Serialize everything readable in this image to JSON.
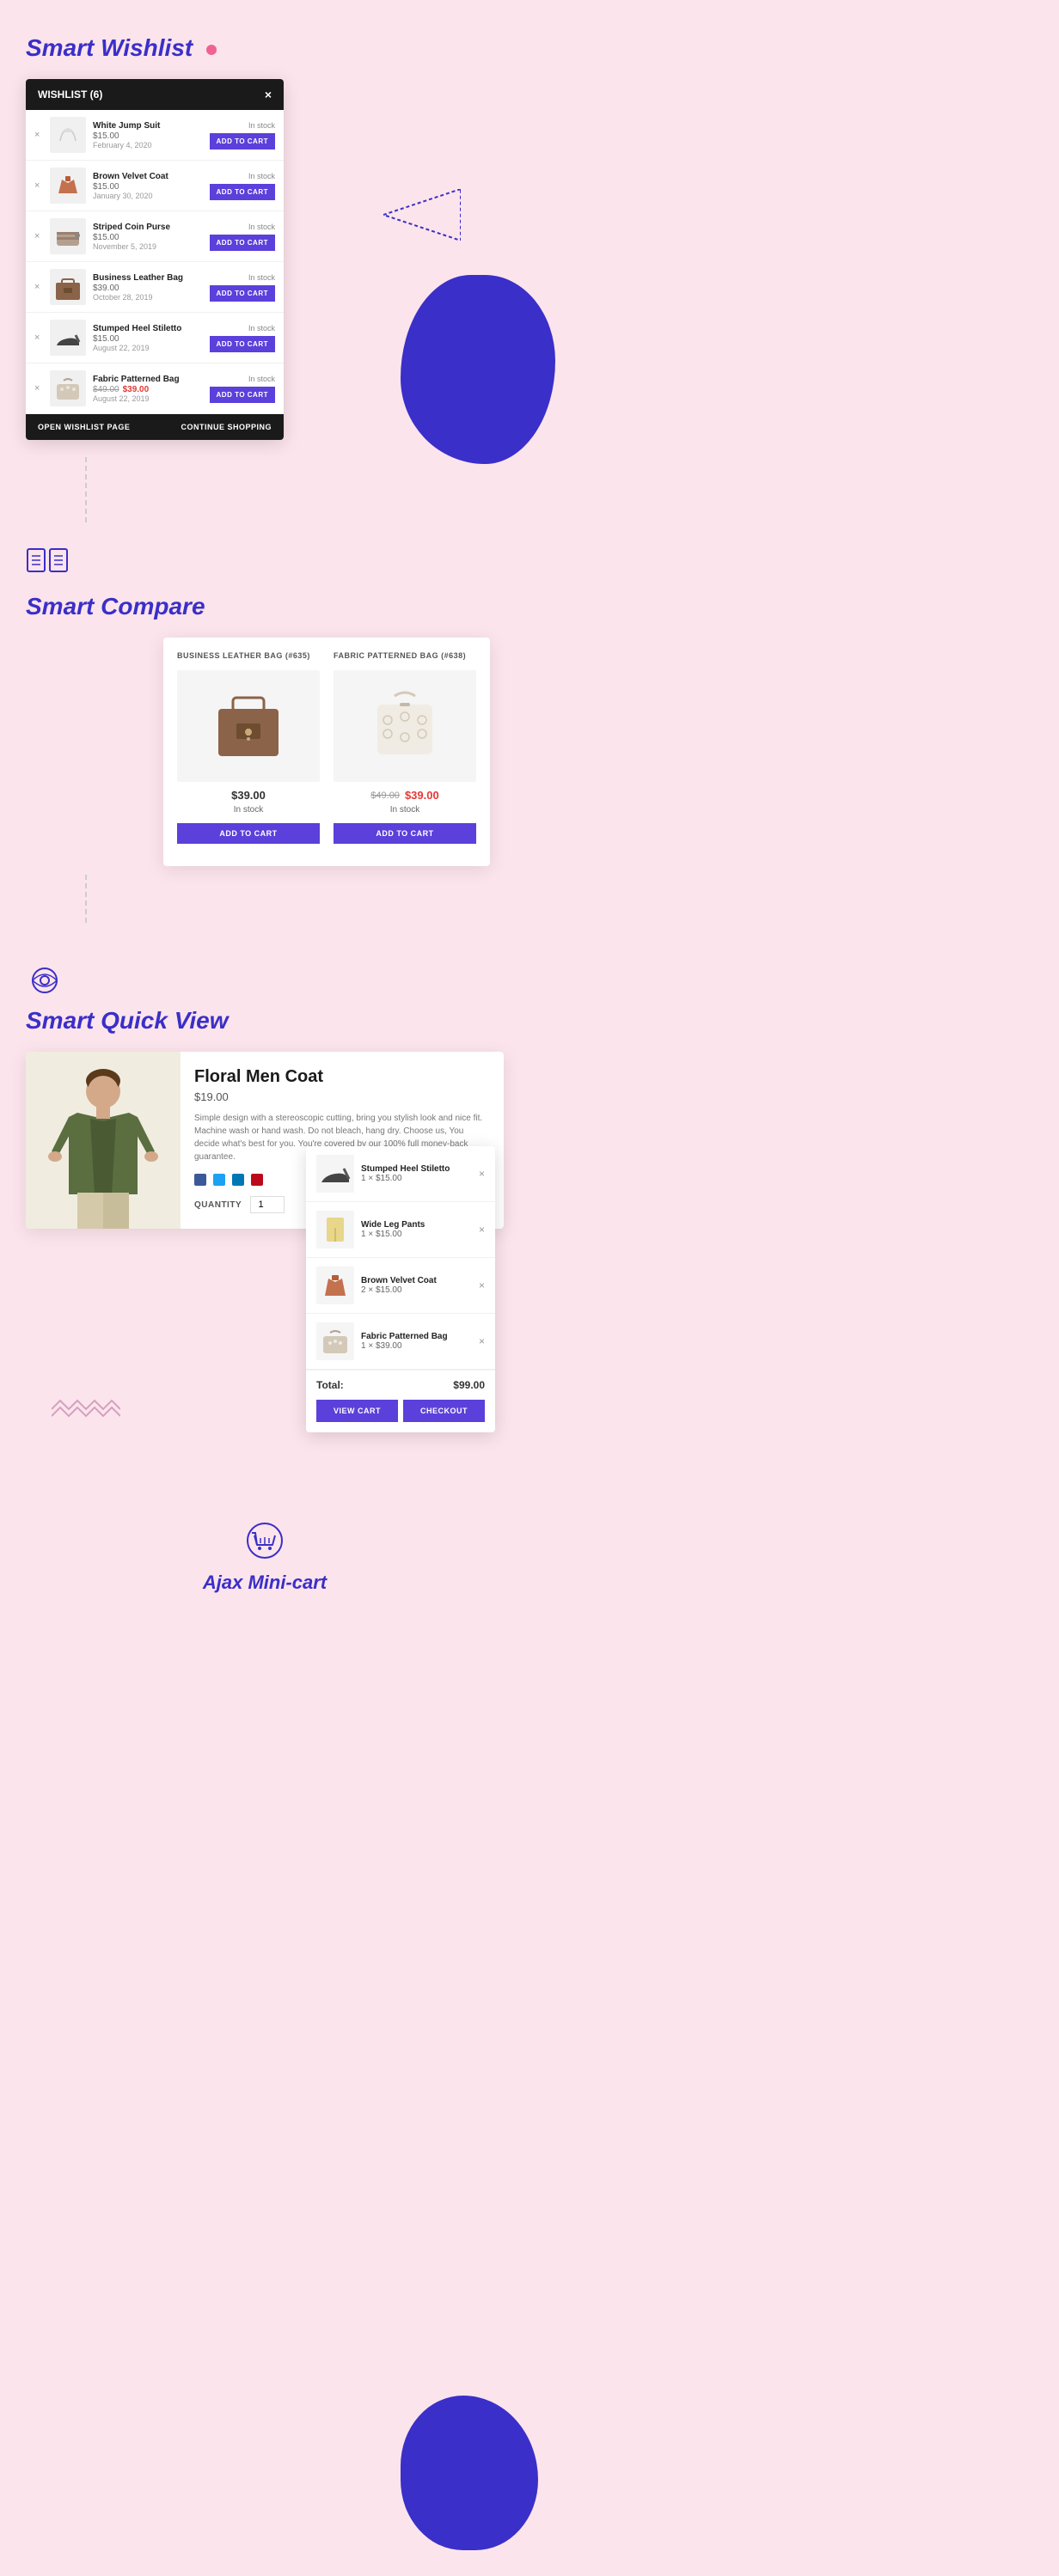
{
  "sections": {
    "wishlist": {
      "title": "Smart Wishlist",
      "panel": {
        "header": "WISHLIST (6)",
        "close_label": "×",
        "items": [
          {
            "name": "White Jump Suit",
            "price": "$15.00",
            "date": "February 4, 2020",
            "stock": "In stock",
            "btn": "ADD TO CART",
            "img_color": "#e8e8e8"
          },
          {
            "name": "Brown Velvet Coat",
            "price": "$15.00",
            "date": "January 30, 2020",
            "stock": "In stock",
            "btn": "ADD TO CART",
            "img_color": "#c4714e"
          },
          {
            "name": "Striped Coin Purse",
            "price": "$15.00",
            "date": "November 5, 2019",
            "stock": "In stock",
            "btn": "ADD TO CART",
            "img_color": "#b5a090"
          },
          {
            "name": "Business Leather Bag",
            "price": "$39.00",
            "date": "October 28, 2019",
            "stock": "In stock",
            "btn": "ADD TO CART",
            "img_color": "#8B6349"
          },
          {
            "name": "Stumped Heel Stiletto",
            "price": "$15.00",
            "date": "August 22, 2019",
            "stock": "In stock",
            "btn": "ADD TO CART",
            "img_color": "#555"
          },
          {
            "name": "Fabric Patterned Bag",
            "price_original": "$49.00",
            "price_sale": "$39.00",
            "date": "August 22, 2019",
            "stock": "In stock",
            "btn": "ADD TO CART",
            "img_color": "#d4c9b8"
          }
        ],
        "footer_left": "OPEN WISHLIST PAGE",
        "footer_right": "CONTINUE SHOPPING"
      }
    },
    "compare": {
      "title": "Smart Compare",
      "products": [
        {
          "id": "#635",
          "name": "BUSINESS LEATHER BAG (#635)",
          "price": "$39.00",
          "stock": "In stock",
          "btn": "ADD TO CART"
        },
        {
          "id": "#638",
          "name": "FABRIC PATTERNED BAG (#638)",
          "price_original": "$49.00",
          "price": "$39.00",
          "stock": "In stock",
          "btn": "ADD TO CART"
        }
      ]
    },
    "quickview": {
      "title": "Smart Quick View",
      "product": {
        "name": "Floral Men Coat",
        "price": "$19.00",
        "description": "Simple design with a stereoscopic cutting, bring you stylish look and nice fit. Machine wash or hand wash. Do not bleach, hang dry. Choose us, You decide what's best for you. You're covered by our 100% full money-back guarantee.",
        "quantity_label": "QUANTITY",
        "quantity_value": "1"
      }
    },
    "minicart": {
      "title": "Ajax Mini-cart",
      "items": [
        {
          "name": "Stumped Heel Stiletto",
          "qty": "1",
          "price": "$15.00",
          "img_color": "#555"
        },
        {
          "name": "Wide Leg Pants",
          "qty": "1",
          "price": "$15.00",
          "img_color": "#e8d68a"
        },
        {
          "name": "Brown Velvet Coat",
          "qty": "2",
          "price": "$15.00",
          "img_color": "#c4714e"
        },
        {
          "name": "Fabric Patterned Bag",
          "qty": "1",
          "price": "$39.00",
          "img_color": "#d4c9b8"
        }
      ],
      "total_label": "Total:",
      "total_amount": "$99.00",
      "btn_view_cart": "VIEW CART",
      "btn_checkout": "CHECKOUT"
    }
  },
  "icons": {
    "compare_icon": "⊞",
    "cart_icon": "🛒",
    "eye_icon": "◎"
  }
}
